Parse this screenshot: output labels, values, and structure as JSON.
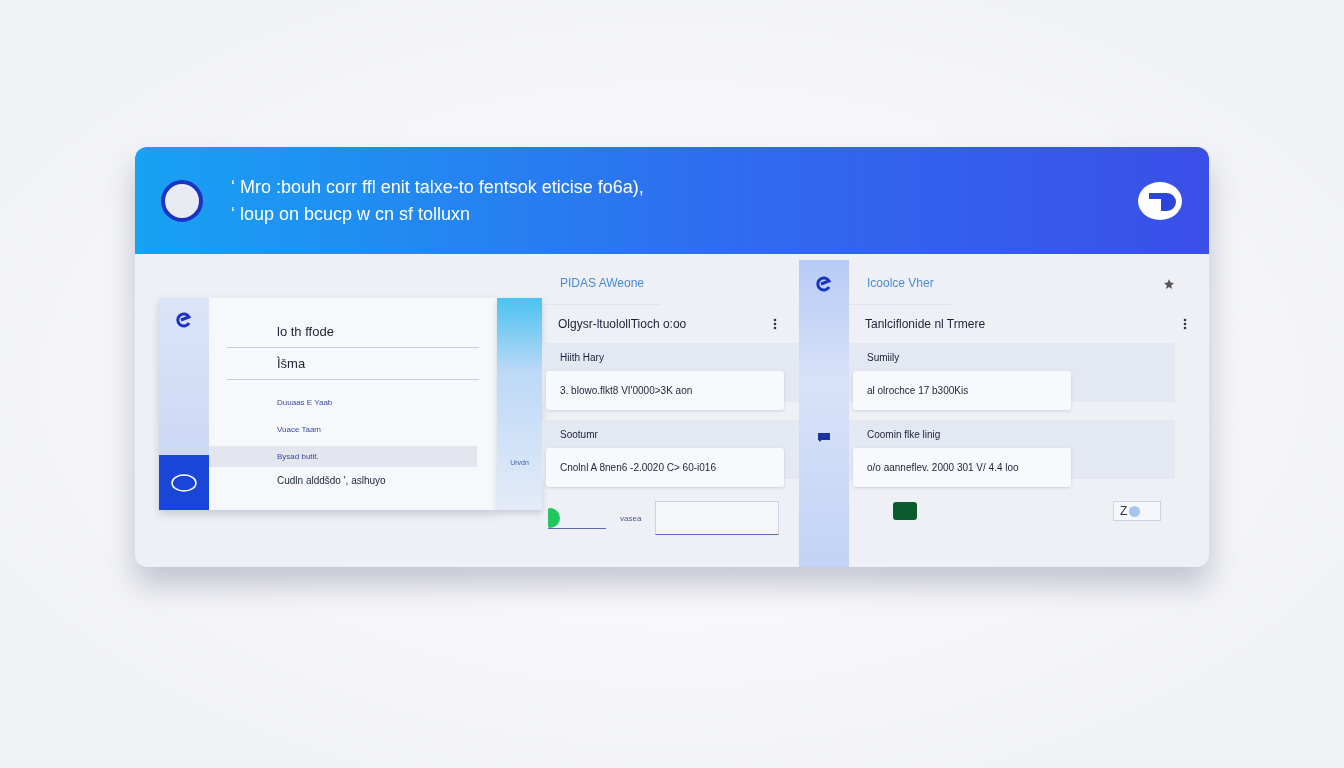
{
  "header": {
    "lines": [
      "‘ Mro :bouh corr ffl  enit talxe-to fentsok eticise fo6a),",
      "‘ loup on bcucp w cn sf tolluxn"
    ]
  },
  "left_panel": {
    "title": "lo th ffode",
    "field": "Ìšma",
    "items": [
      {
        "text": "Duuaas E Yaab",
        "selected": false
      },
      {
        "text": "Vuace Taam",
        "selected": false
      },
      {
        "text": "Bysad butit.",
        "selected": true
      }
    ],
    "footer": "Cudln alddšdo ', aslhuyo"
  },
  "side_column": {
    "label": "Urvdn"
  },
  "middle_panel": {
    "heading": "PIDAS AWeone",
    "title": "Olgysr-ltuolollTioch o:oo",
    "sections": [
      {
        "label": "Hiith Hary",
        "value": "3. blowo.flkt8  VI'0000>3K aon"
      },
      {
        "label": "Sootumr",
        "value": "Cnolnl A 8nen6 -2.0020 C> 60-i016"
      }
    ],
    "toggle": {
      "on": true,
      "label": "vasea"
    }
  },
  "right_panel": {
    "heading": "Icoolce  Vher",
    "title": "Tanlciflonide nl Trmere",
    "sections": [
      {
        "label": "Sumiily",
        "value": "al olrochce 17 b300Kis"
      },
      {
        "label": "Coomin flke linig",
        "value": "o/o aanneflev. 2000 301 V/ 4.4 loo"
      }
    ],
    "toggle": {
      "on": false,
      "label": "Z"
    }
  }
}
